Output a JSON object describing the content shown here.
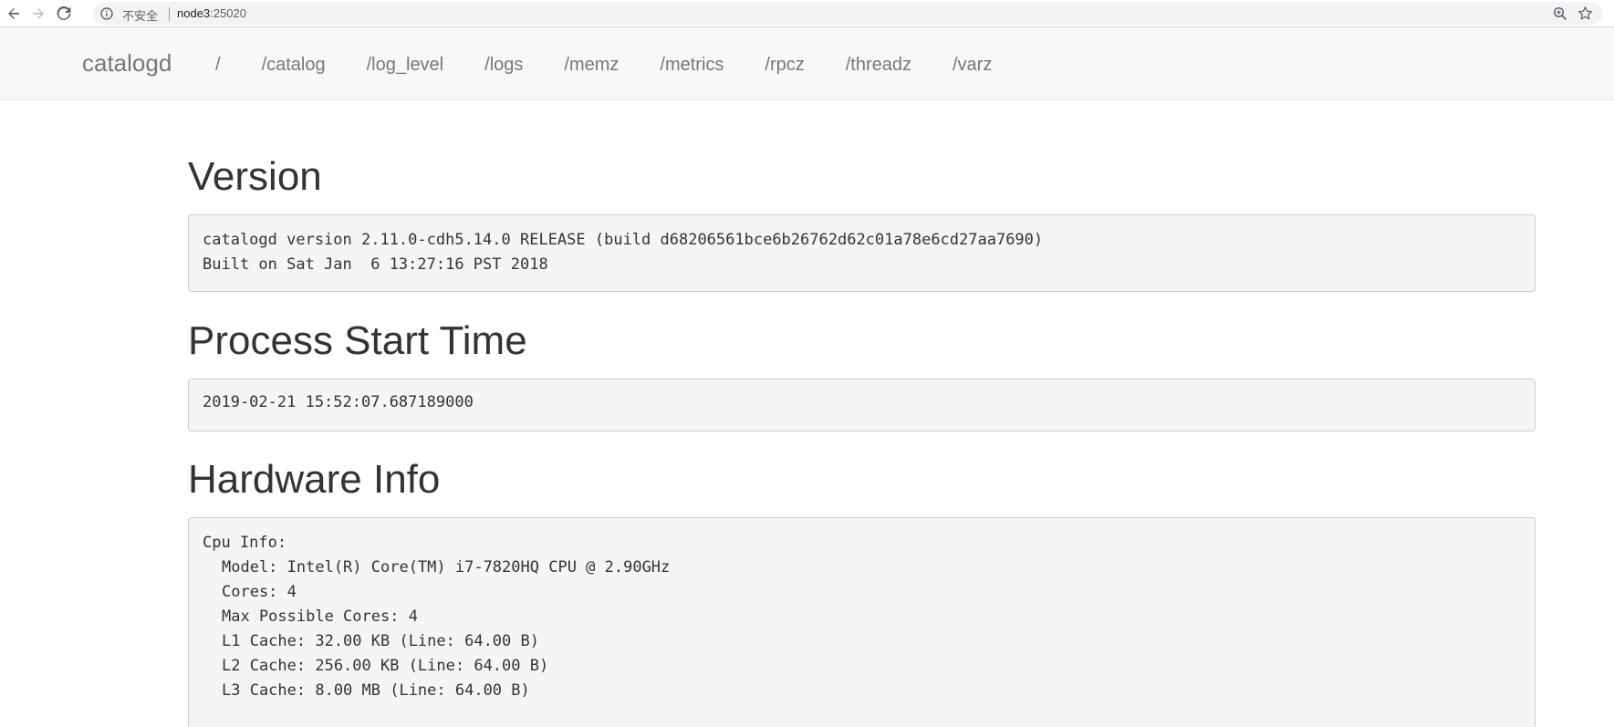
{
  "browser": {
    "security_label": "不安全",
    "url_host": "node3",
    "url_port": ":25020"
  },
  "navbar": {
    "brand": "catalogd",
    "links": [
      "/",
      "/catalog",
      "/log_level",
      "/logs",
      "/memz",
      "/metrics",
      "/rpcz",
      "/threadz",
      "/varz"
    ]
  },
  "sections": {
    "version": {
      "title": "Version",
      "lines": [
        "catalogd version 2.11.0-cdh5.14.0 RELEASE (build d68206561bce6b26762d62c01a78e6cd27aa7690)",
        "Built on Sat Jan  6 13:27:16 PST 2018"
      ]
    },
    "start_time": {
      "title": "Process Start Time",
      "value": "2019-02-21 15:52:07.687189000"
    },
    "hardware": {
      "title": "Hardware Info",
      "header": "Cpu Info:",
      "lines": [
        "Model: Intel(R) Core(TM) i7-7820HQ CPU @ 2.90GHz",
        "Cores: 4",
        "Max Possible Cores: 4",
        "L1 Cache: 32.00 KB (Line: 64.00 B)",
        "L2 Cache: 256.00 KB (Line: 64.00 B)",
        "L3 Cache: 8.00 MB (Line: 64.00 B)"
      ]
    }
  }
}
